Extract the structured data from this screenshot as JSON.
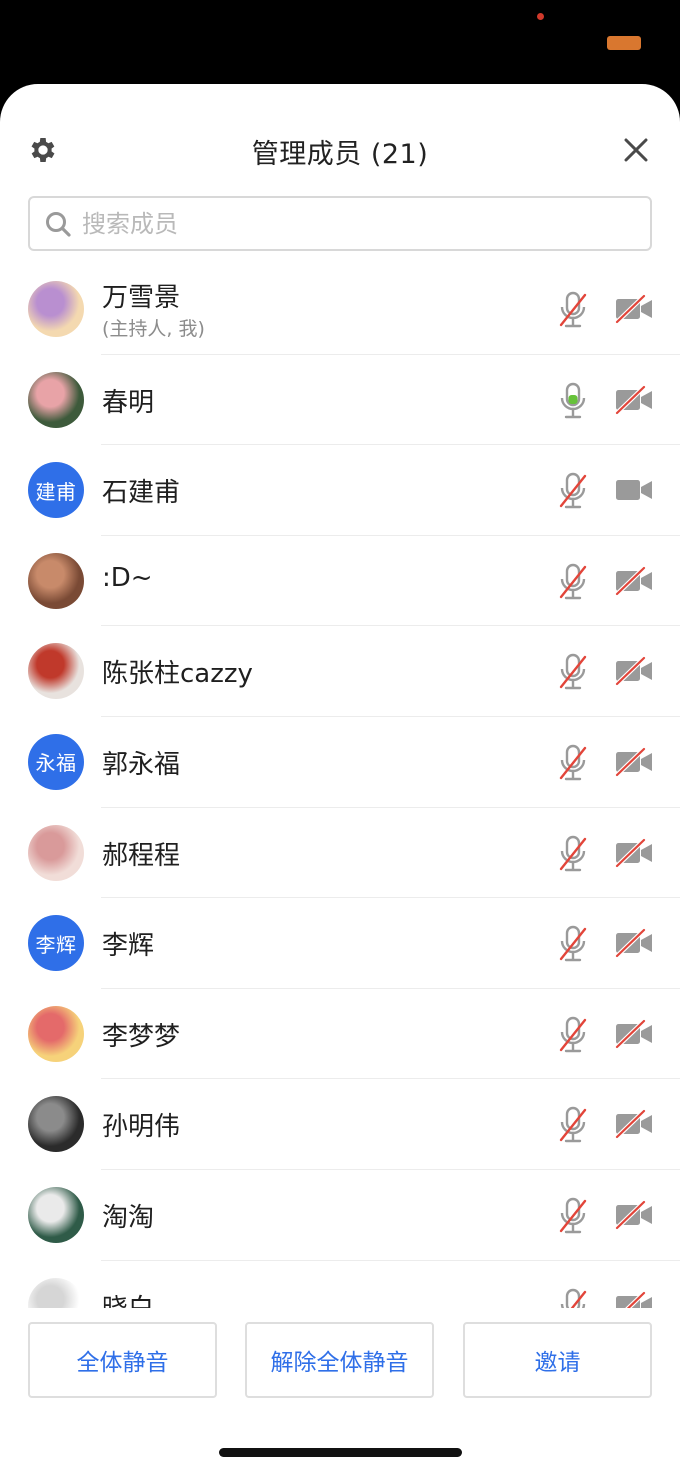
{
  "status": {
    "accent_dot": "#d0392b",
    "pill": "#d9772f"
  },
  "header": {
    "title": "管理成员 (21)",
    "settings_icon": "gear-icon",
    "close_icon": "close-icon"
  },
  "search": {
    "placeholder": "搜索成员",
    "value": ""
  },
  "colors": {
    "accent": "#2f6fe8",
    "muted_red": "#e2453a",
    "icon_gray": "#9a9a9a",
    "mic_active": "#67c23a"
  },
  "members": [
    {
      "name": "万雪景",
      "sub": "(主持人, 我)",
      "avatar_type": "image",
      "avatar_colors": [
        "#f4d9b0",
        "#b98fd0"
      ],
      "mic": "muted",
      "cam": "off"
    },
    {
      "name": "春明",
      "sub": "",
      "avatar_type": "image",
      "avatar_colors": [
        "#3d5a3b",
        "#e8a3a7"
      ],
      "mic": "active",
      "cam": "off"
    },
    {
      "name": "石建甫",
      "sub": "",
      "avatar_type": "text",
      "avatar_text": "建甫",
      "mic": "muted",
      "cam": "on"
    },
    {
      "name": ":D~",
      "sub": "",
      "avatar_type": "image",
      "avatar_colors": [
        "#7a4a35",
        "#c88a6a"
      ],
      "mic": "muted",
      "cam": "off"
    },
    {
      "name": "陈张柱cazzy",
      "sub": "",
      "avatar_type": "image",
      "avatar_colors": [
        "#e8e2de",
        "#c0392b"
      ],
      "mic": "muted",
      "cam": "off"
    },
    {
      "name": "郭永福",
      "sub": "",
      "avatar_type": "text",
      "avatar_text": "永福",
      "mic": "muted",
      "cam": "off"
    },
    {
      "name": "郝程程",
      "sub": "",
      "avatar_type": "image",
      "avatar_colors": [
        "#f1ddd8",
        "#d99a9a"
      ],
      "mic": "muted",
      "cam": "off"
    },
    {
      "name": "李辉",
      "sub": "",
      "avatar_type": "text",
      "avatar_text": "李辉",
      "mic": "muted",
      "cam": "off"
    },
    {
      "name": "李梦梦",
      "sub": "",
      "avatar_type": "image",
      "avatar_colors": [
        "#f6d27a",
        "#e46a6a"
      ],
      "mic": "muted",
      "cam": "off"
    },
    {
      "name": "孙明伟",
      "sub": "",
      "avatar_type": "image",
      "avatar_colors": [
        "#2b2b2b",
        "#8b8b8b"
      ],
      "mic": "muted",
      "cam": "off"
    },
    {
      "name": "淘淘",
      "sub": "",
      "avatar_type": "image",
      "avatar_colors": [
        "#2f5b48",
        "#eaeaea"
      ],
      "mic": "muted",
      "cam": "off"
    },
    {
      "name": "晓白",
      "sub": "",
      "avatar_type": "image",
      "avatar_colors": [
        "#ffffff",
        "#d6d6d6"
      ],
      "mic": "muted",
      "cam": "off"
    }
  ],
  "footer": {
    "mute_all": "全体静音",
    "unmute_all": "解除全体静音",
    "invite": "邀请"
  }
}
